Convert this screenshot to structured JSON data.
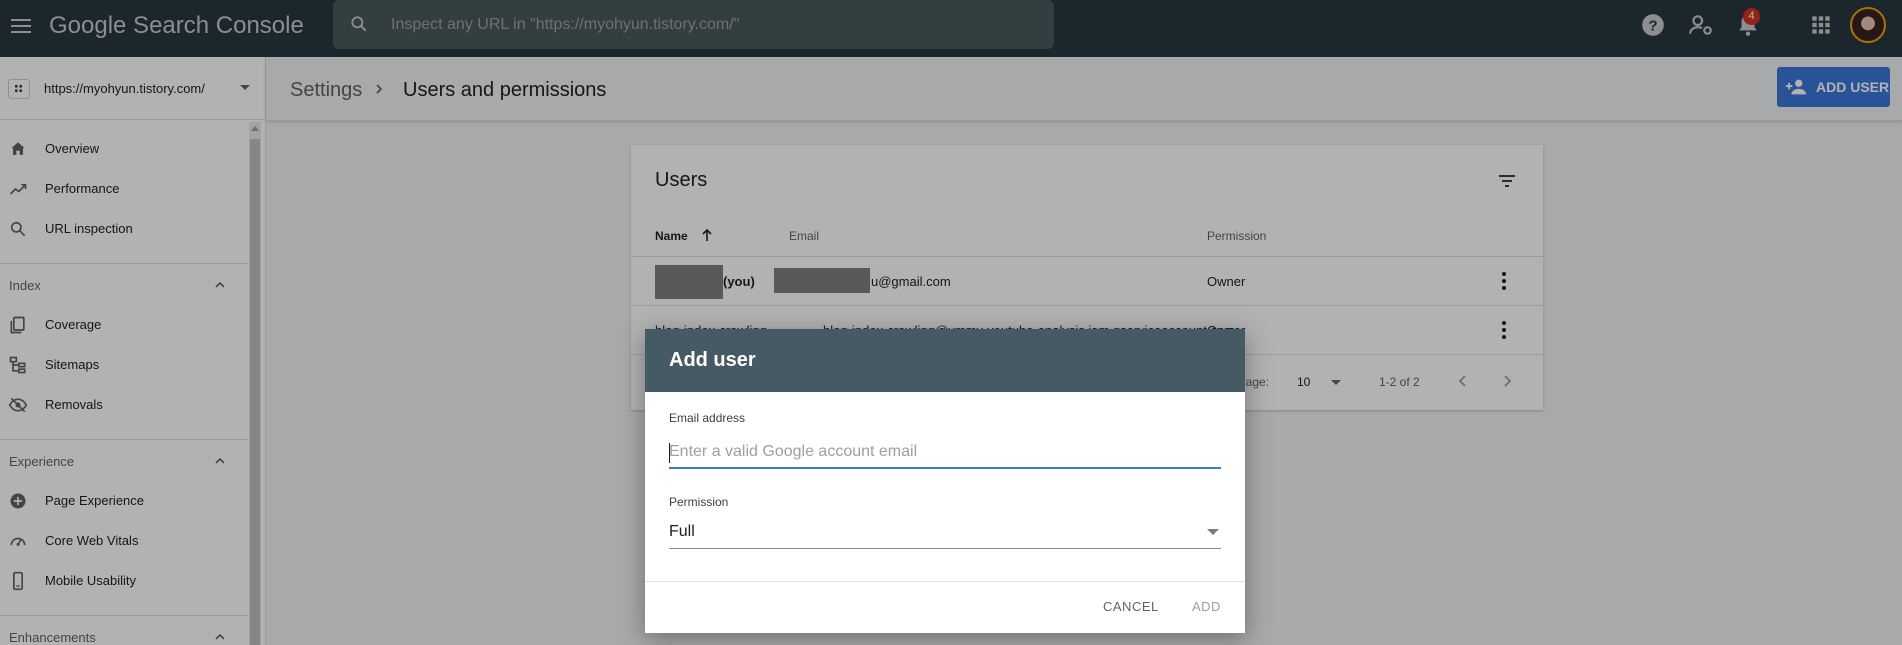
{
  "app": {
    "title": "Google Search Console",
    "search_placeholder": "Inspect any URL in \"https://myohyun.tistory.com/\"",
    "notification_count": "4"
  },
  "sidebar": {
    "property": "https://myohyun.tistory.com/",
    "items": [
      {
        "label": "Overview",
        "icon": "home-icon"
      },
      {
        "label": "Performance",
        "icon": "trending-up-icon"
      },
      {
        "label": "URL inspection",
        "icon": "search-icon"
      }
    ],
    "sections": [
      {
        "label": "Index",
        "items": [
          {
            "label": "Coverage",
            "icon": "coverage-icon"
          },
          {
            "label": "Sitemaps",
            "icon": "sitemap-icon"
          },
          {
            "label": "Removals",
            "icon": "removals-icon"
          }
        ]
      },
      {
        "label": "Experience",
        "items": [
          {
            "label": "Page Experience",
            "icon": "page-experience-icon"
          },
          {
            "label": "Core Web Vitals",
            "icon": "gauge-icon"
          },
          {
            "label": "Mobile Usability",
            "icon": "phone-icon"
          }
        ]
      },
      {
        "label": "Enhancements",
        "items": []
      }
    ]
  },
  "header": {
    "breadcrumb": [
      "Settings",
      "Users and permissions"
    ],
    "add_user_label": "ADD USER"
  },
  "users_card": {
    "title": "Users",
    "columns": [
      "Name",
      "Email",
      "Permission"
    ],
    "rows": [
      {
        "name": "(you)",
        "email": "u@gmail.com",
        "permission": "Owner"
      },
      {
        "name": "blog-index-crawling",
        "email": "blog-index-crawling@ymmy-youtube-analysis.iam.gserviceaccount.com",
        "permission": "Owner"
      }
    ],
    "pagination": {
      "label": "page:",
      "value": "10",
      "range": "1-2 of 2"
    }
  },
  "dialog": {
    "title": "Add user",
    "email_label": "Email address",
    "email_placeholder": "Enter a valid Google account email",
    "email_value": "",
    "permission_label": "Permission",
    "permission_value": "Full",
    "cancel_label": "CANCEL",
    "add_label": "ADD"
  },
  "colors": {
    "topbar": "#28393f",
    "accent": "#3c78d8",
    "dialog_header": "#455a64"
  }
}
